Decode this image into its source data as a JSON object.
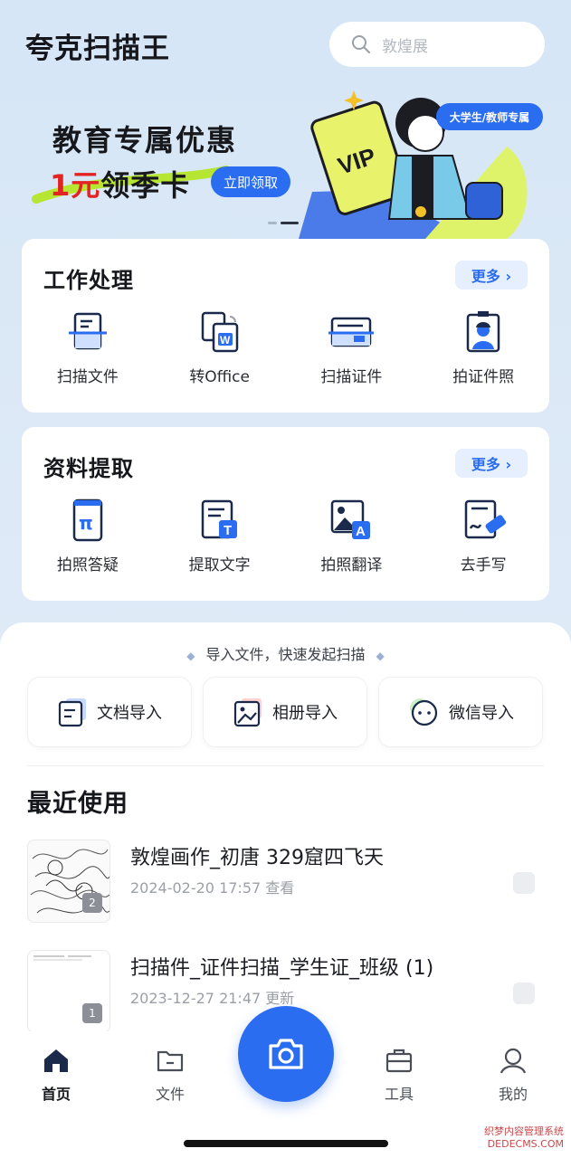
{
  "app": {
    "title": "夸克扫描王"
  },
  "search": {
    "placeholder": "敦煌展"
  },
  "banner": {
    "line1": "教育专属优惠",
    "line2_red": "1元",
    "line2_rest": "领季卡",
    "button": "立即领取",
    "tag": "大学生/教师专属",
    "card_text": "VIP"
  },
  "work": {
    "title": "工作处理",
    "more": "更多 ›",
    "items": [
      {
        "label": "扫描文件",
        "icon": "scan-file-icon"
      },
      {
        "label": "转Office",
        "icon": "word-doc-icon"
      },
      {
        "label": "扫描证件",
        "icon": "id-card-icon"
      },
      {
        "label": "拍证件照",
        "icon": "id-photo-icon"
      }
    ]
  },
  "extract": {
    "title": "资料提取",
    "more": "更多 ›",
    "items": [
      {
        "label": "拍照答疑",
        "icon": "pi-phone-icon",
        "glyph": "π"
      },
      {
        "label": "提取文字",
        "icon": "text-extract-icon",
        "glyph": "T"
      },
      {
        "label": "拍照翻译",
        "icon": "translate-image-icon",
        "glyph": "A"
      },
      {
        "label": "去手写",
        "icon": "erase-handwriting-icon"
      }
    ]
  },
  "import": {
    "hint": "导入文件，快速发起扫描",
    "buttons": [
      {
        "label": "文档导入",
        "icon": "document-import-icon"
      },
      {
        "label": "相册导入",
        "icon": "album-import-icon"
      },
      {
        "label": "微信导入",
        "icon": "wechat-import-icon"
      }
    ]
  },
  "recent": {
    "title": "最近使用",
    "items": [
      {
        "title": "敦煌画作_初唐 329窟四飞天",
        "meta": "2024-02-20 17:57 查看",
        "count": "2"
      },
      {
        "title": "扫描件_证件扫描_学生证_班级 (1)",
        "meta": "2023-12-27 21:47 更新",
        "count": "1"
      }
    ]
  },
  "tabs": [
    {
      "label": "首页",
      "icon": "home-icon",
      "active": true
    },
    {
      "label": "文件",
      "icon": "folder-icon",
      "active": false
    },
    {
      "label": "工具",
      "icon": "toolbox-icon",
      "active": false
    },
    {
      "label": "我的",
      "icon": "profile-icon",
      "active": false
    }
  ],
  "watermark": {
    "line1": "织梦内容管理系统",
    "line2": "DEDECMS.COM"
  },
  "colors": {
    "accent": "#2b6df0",
    "promo_red": "#e32222",
    "background": "#d6e6f6"
  }
}
